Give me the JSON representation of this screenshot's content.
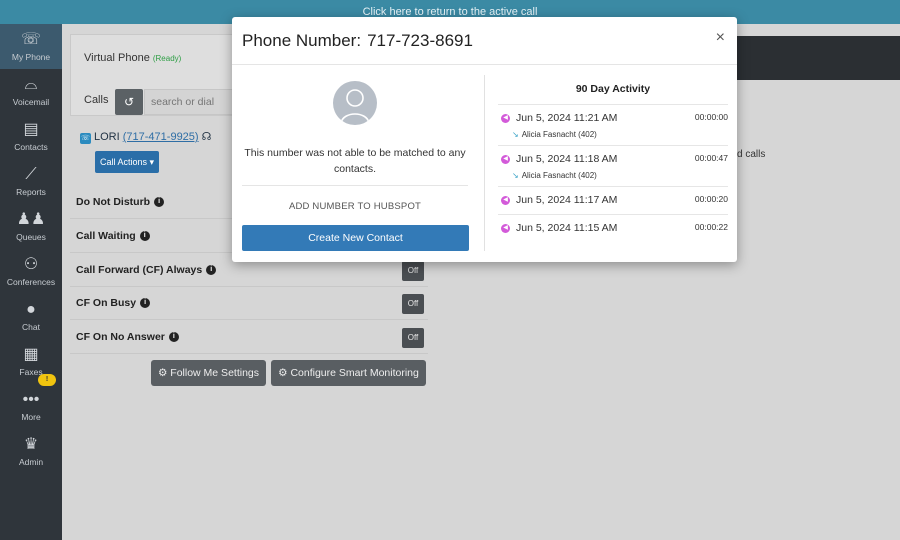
{
  "banner": {
    "text": "Click here to return to the active call"
  },
  "sidebar": {
    "items": [
      {
        "label": "My Phone",
        "icon": "phone-icon",
        "active": true
      },
      {
        "label": "Voicemail",
        "icon": "voicemail-icon"
      },
      {
        "label": "Contacts",
        "icon": "contacts-icon"
      },
      {
        "label": "Reports",
        "icon": "chart-icon"
      },
      {
        "label": "Queues",
        "icon": "people-icon"
      },
      {
        "label": "Conferences",
        "icon": "conference-icon"
      },
      {
        "label": "Chat",
        "icon": "chat-icon"
      },
      {
        "label": "Faxes",
        "icon": "fax-icon"
      },
      {
        "label": "More",
        "icon": "more-icon"
      },
      {
        "label": "Admin",
        "icon": "crown-icon"
      }
    ],
    "more_badge": "!"
  },
  "phone_panel": {
    "title": "Virtual Phone",
    "status": "(Ready)",
    "calls_label": "Calls",
    "search_placeholder": "search or dial",
    "contact_name": "LORI",
    "contact_number": "(717-471-9925)",
    "call_actions_label": "Call Actions ▾"
  },
  "settings": [
    {
      "label": "Do Not Disturb"
    },
    {
      "label": "Call Waiting"
    },
    {
      "label": "Call Forward (CF) Always",
      "state": "Off"
    },
    {
      "label": "CF On Busy",
      "state": "Off"
    },
    {
      "label": "CF On No Answer",
      "state": "Off"
    }
  ],
  "buttons": {
    "follow_me": "⚙ Follow Me Settings",
    "smart_monitoring": "⚙ Configure Smart Monitoring"
  },
  "behind_text": "d calls",
  "modal": {
    "title_lead": "Phone Number:",
    "phone": "717-723-8691",
    "close": "×",
    "no_match_text": "This number was not able to be matched to any contacts.",
    "add_hubspot": "ADD NUMBER TO HUBSPOT",
    "create_contact": "Create New Contact",
    "activity_title": "90 Day Activity",
    "activity": [
      {
        "date": "Jun 5, 2024 11:21 AM",
        "duration": "00:00:00",
        "agent": "Alicia Fasnacht (402)"
      },
      {
        "date": "Jun 5, 2024 11:18 AM",
        "duration": "00:00:47",
        "agent": "Alicia Fasnacht (402)"
      },
      {
        "date": "Jun 5, 2024 11:17 AM",
        "duration": "00:00:20"
      },
      {
        "date": "Jun 5, 2024 11:15 AM",
        "duration": "00:00:22"
      }
    ]
  },
  "colors": {
    "banner": "#3b8aa4",
    "sidebar": "#2f353b",
    "primary_button": "#337ab7",
    "activity_dot": "#d35ad9",
    "status_ready": "#2e9e45"
  }
}
